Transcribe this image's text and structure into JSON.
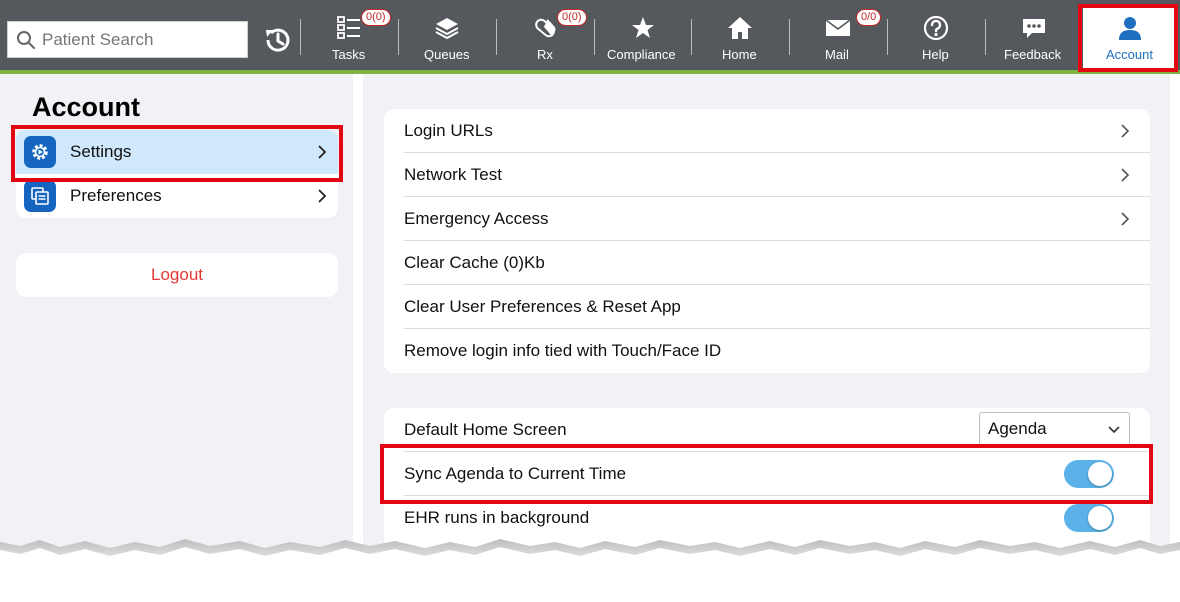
{
  "search": {
    "placeholder": "Patient Search"
  },
  "nav": {
    "tasks": {
      "label": "Tasks",
      "badge": "0(0)"
    },
    "queues": {
      "label": "Queues"
    },
    "rx": {
      "label": "Rx",
      "badge": "0(0)"
    },
    "compliance": {
      "label": "Compliance"
    },
    "home": {
      "label": "Home"
    },
    "mail": {
      "label": "Mail",
      "badge": "0/0"
    },
    "help": {
      "label": "Help"
    },
    "feedback": {
      "label": "Feedback"
    },
    "account": {
      "label": "Account"
    }
  },
  "sidebar": {
    "title": "Account",
    "items": [
      {
        "label": "Settings",
        "icon": "gear-icon",
        "selected": true
      },
      {
        "label": "Preferences",
        "icon": "preferences-icon",
        "selected": false
      }
    ],
    "logout_label": "Logout"
  },
  "settings": {
    "group1": [
      {
        "label": "Login URLs",
        "chevron": true
      },
      {
        "label": "Network Test",
        "chevron": true
      },
      {
        "label": "Emergency Access",
        "chevron": true
      },
      {
        "label": "Clear Cache (0)Kb",
        "chevron": false
      },
      {
        "label": "Clear User Preferences & Reset App",
        "chevron": false
      },
      {
        "label": "Remove login info tied with Touch/Face ID",
        "chevron": false
      }
    ],
    "group2": {
      "default_home": {
        "label": "Default Home Screen",
        "value": "Agenda"
      },
      "sync_agenda": {
        "label": "Sync Agenda to Current Time",
        "on": true
      },
      "ehr_background": {
        "label": "EHR runs in background",
        "on": true
      }
    }
  },
  "colors": {
    "topbar": "#55585c",
    "accent_green": "#7cb342",
    "accent_blue": "#1e6fbf",
    "toggle_on": "#5bb2e8",
    "logout_red": "#e53935",
    "highlight_red": "#e30613"
  }
}
